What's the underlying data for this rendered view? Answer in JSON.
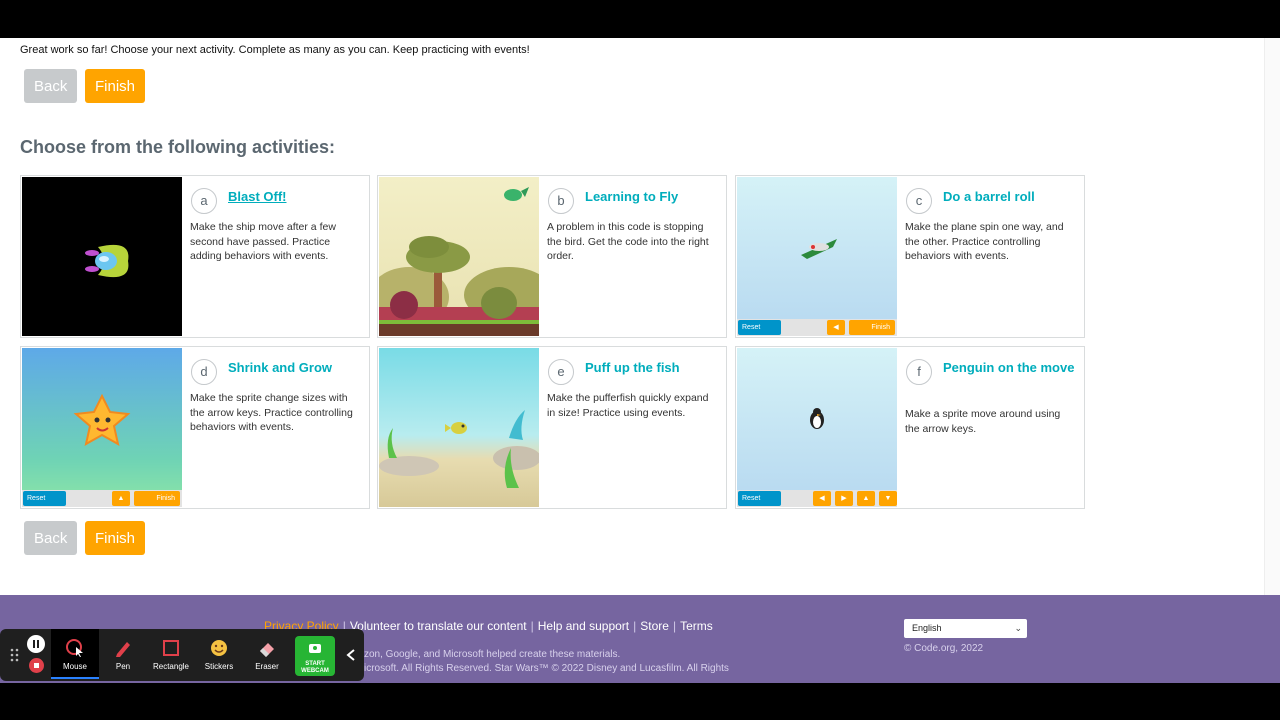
{
  "intro_text": "Great work so far! Choose your next activity. Complete as many as you can. Keep practicing with events!",
  "buttons": {
    "back": "Back",
    "finish": "Finish"
  },
  "heading": "Choose from the following activities:",
  "activities": [
    {
      "letter": "a",
      "title": "Blast Off!",
      "description": "Make the ship move after a few second have passed. Practice adding behaviors with events."
    },
    {
      "letter": "b",
      "title": "Learning to Fly",
      "description": "A problem in this code is stopping the bird. Get the code into the right order."
    },
    {
      "letter": "c",
      "title": "Do a barrel roll",
      "description": "Make the plane spin one way, and the other. Practice controlling behaviors with events."
    },
    {
      "letter": "d",
      "title": "Shrink and Grow",
      "description": "Make the sprite change sizes with the arrow keys. Practice controlling behaviors with events."
    },
    {
      "letter": "e",
      "title": "Puff up the fish",
      "description": "Make the pufferfish quickly expand in size! Practice using events."
    },
    {
      "letter": "f",
      "title": "Penguin on the move",
      "description": "Make a sprite move around using the arrow keys."
    }
  ],
  "minibar": {
    "reset": "Reset",
    "finish": "Finish"
  },
  "footer": {
    "links": [
      "Privacy Policy",
      "Volunteer to translate our content",
      "Help and support",
      "Store",
      "Terms"
    ],
    "line1": "zon, Google, and Microsoft helped create these materials.",
    "line2": "icrosoft. All Rights Reserved. Star Wars™ © 2022 Disney and Lucasfilm. All Rights",
    "language": "English",
    "copyright": "© Code.org, 2022"
  },
  "toolbar": {
    "tools": [
      "Mouse",
      "Pen",
      "Rectangle",
      "Stickers",
      "Eraser"
    ],
    "webcam": "START WEBCAM"
  },
  "colors": {
    "accent": "#00adbc",
    "finish": "#ffa400",
    "back": "#c7cacc",
    "footer": "#7665a0"
  }
}
